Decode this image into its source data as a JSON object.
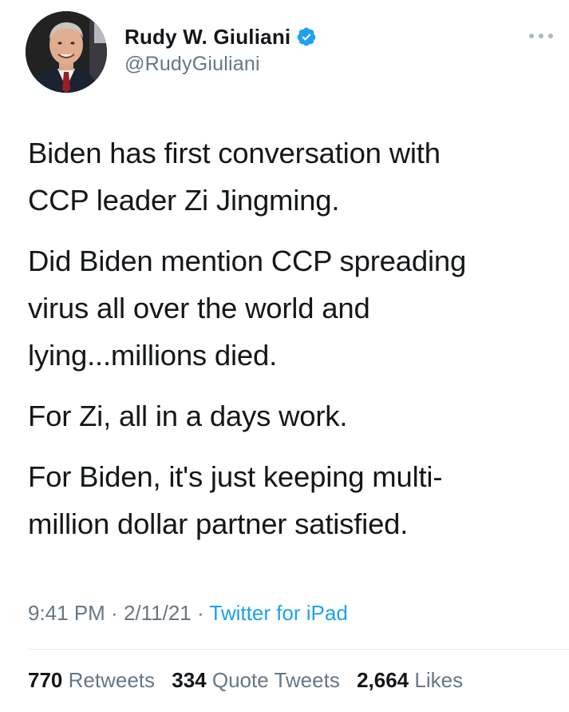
{
  "author": {
    "display_name": "Rudy W. Giuliani",
    "handle": "@RudyGiuliani",
    "verified": true,
    "avatar_icon": "profile-photo"
  },
  "tweet": {
    "paragraphs": [
      "Biden has first conversation with\nCCP leader Zi Jingming.",
      "Did Biden mention CCP spreading\nvirus all over the world and\nlying...millions died.",
      "For Zi, all in a days work.",
      "For Biden, it's just keeping multi-\nmillion dollar partner satisfied."
    ]
  },
  "meta": {
    "time": "9:41 PM",
    "separator": " · ",
    "date": "2/11/21",
    "source": "Twitter for iPad"
  },
  "stats": {
    "retweets_count": "770",
    "retweets_label": "Retweets",
    "quote_count": "334",
    "quote_label": "Quote Tweets",
    "likes_count": "2,664",
    "likes_label": "Likes"
  },
  "colors": {
    "text": "#14171a",
    "secondary": "#657786",
    "accent": "#1da1f2",
    "divider": "#e1e8ed"
  }
}
